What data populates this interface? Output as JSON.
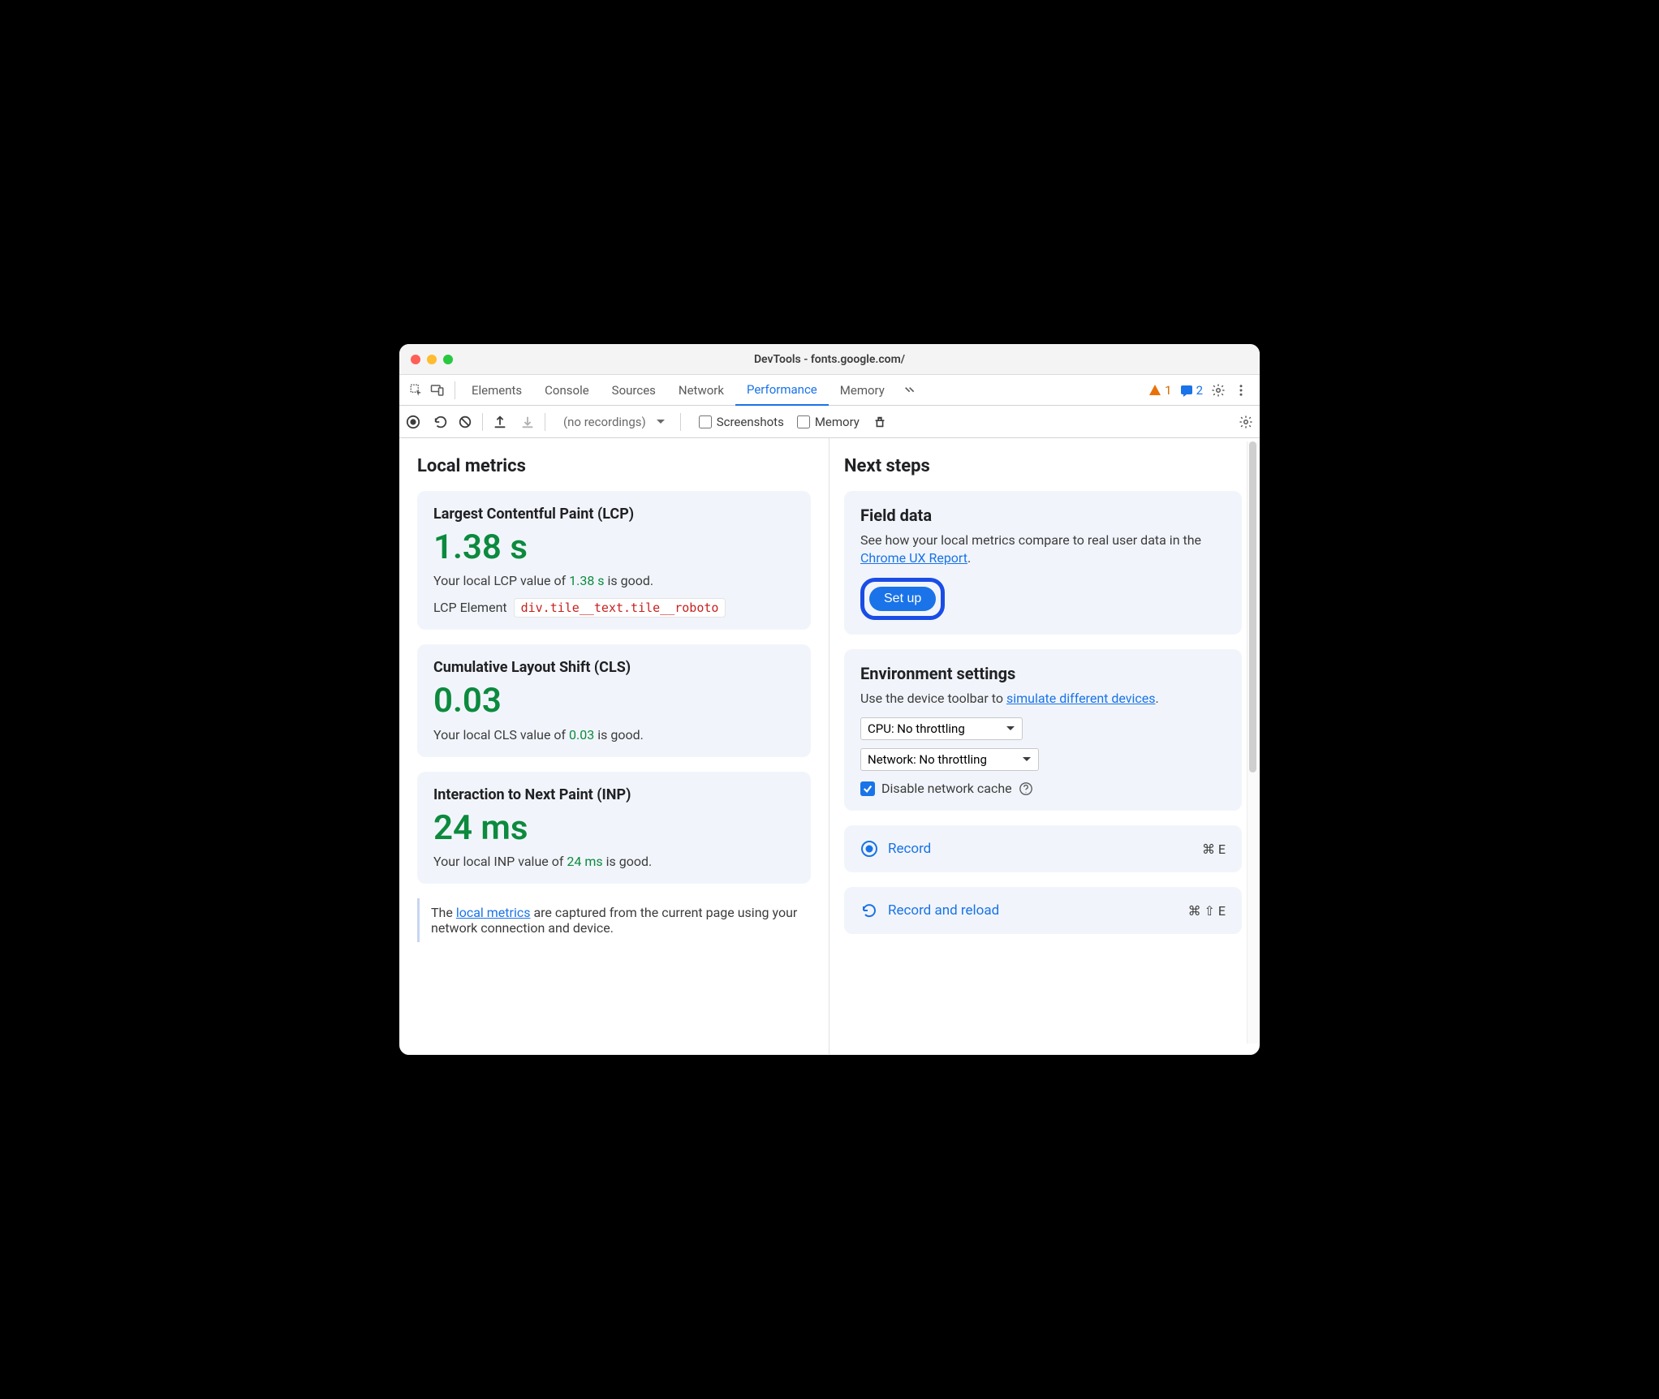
{
  "title": "DevTools - fonts.google.com/",
  "tabs": {
    "elements": "Elements",
    "console": "Console",
    "sources": "Sources",
    "network": "Network",
    "performance": "Performance",
    "memory": "Memory"
  },
  "issues": {
    "warn_count": "1",
    "info_count": "2"
  },
  "toolbar": {
    "recordings_dropdown": "(no recordings)",
    "screenshots_label": "Screenshots",
    "memory_label": "Memory"
  },
  "left": {
    "heading": "Local metrics",
    "lcp": {
      "title": "Largest Contentful Paint (LCP)",
      "value": "1.38 s",
      "desc_prefix": "Your local LCP value of ",
      "desc_value": "1.38 s",
      "desc_suffix": " is good.",
      "element_label": "LCP Element",
      "element_code": "div.tile__text.tile__roboto"
    },
    "cls": {
      "title": "Cumulative Layout Shift (CLS)",
      "value": "0.03",
      "desc_prefix": "Your local CLS value of ",
      "desc_value": "0.03",
      "desc_suffix": " is good."
    },
    "inp": {
      "title": "Interaction to Next Paint (INP)",
      "value": "24 ms",
      "desc_prefix": "Your local INP value of ",
      "desc_value": "24 ms",
      "desc_suffix": " is good."
    },
    "note_prefix": "The ",
    "note_link": "local metrics",
    "note_suffix": " are captured from the current page using your network connection and device."
  },
  "right": {
    "heading": "Next steps",
    "field": {
      "title": "Field data",
      "text_prefix": "See how your local metrics compare to real user data in the ",
      "link": "Chrome UX Report",
      "text_suffix": ".",
      "button": "Set up"
    },
    "env": {
      "title": "Environment settings",
      "text_prefix": "Use the device toolbar to ",
      "link": "simulate different devices",
      "text_suffix": ".",
      "cpu_option": "CPU: No throttling",
      "net_option": "Network: No throttling",
      "disable_cache": "Disable network cache"
    },
    "record": {
      "label": "Record",
      "shortcut": "⌘ E"
    },
    "reload": {
      "label": "Record and reload",
      "shortcut": "⌘ ⇧ E"
    }
  }
}
